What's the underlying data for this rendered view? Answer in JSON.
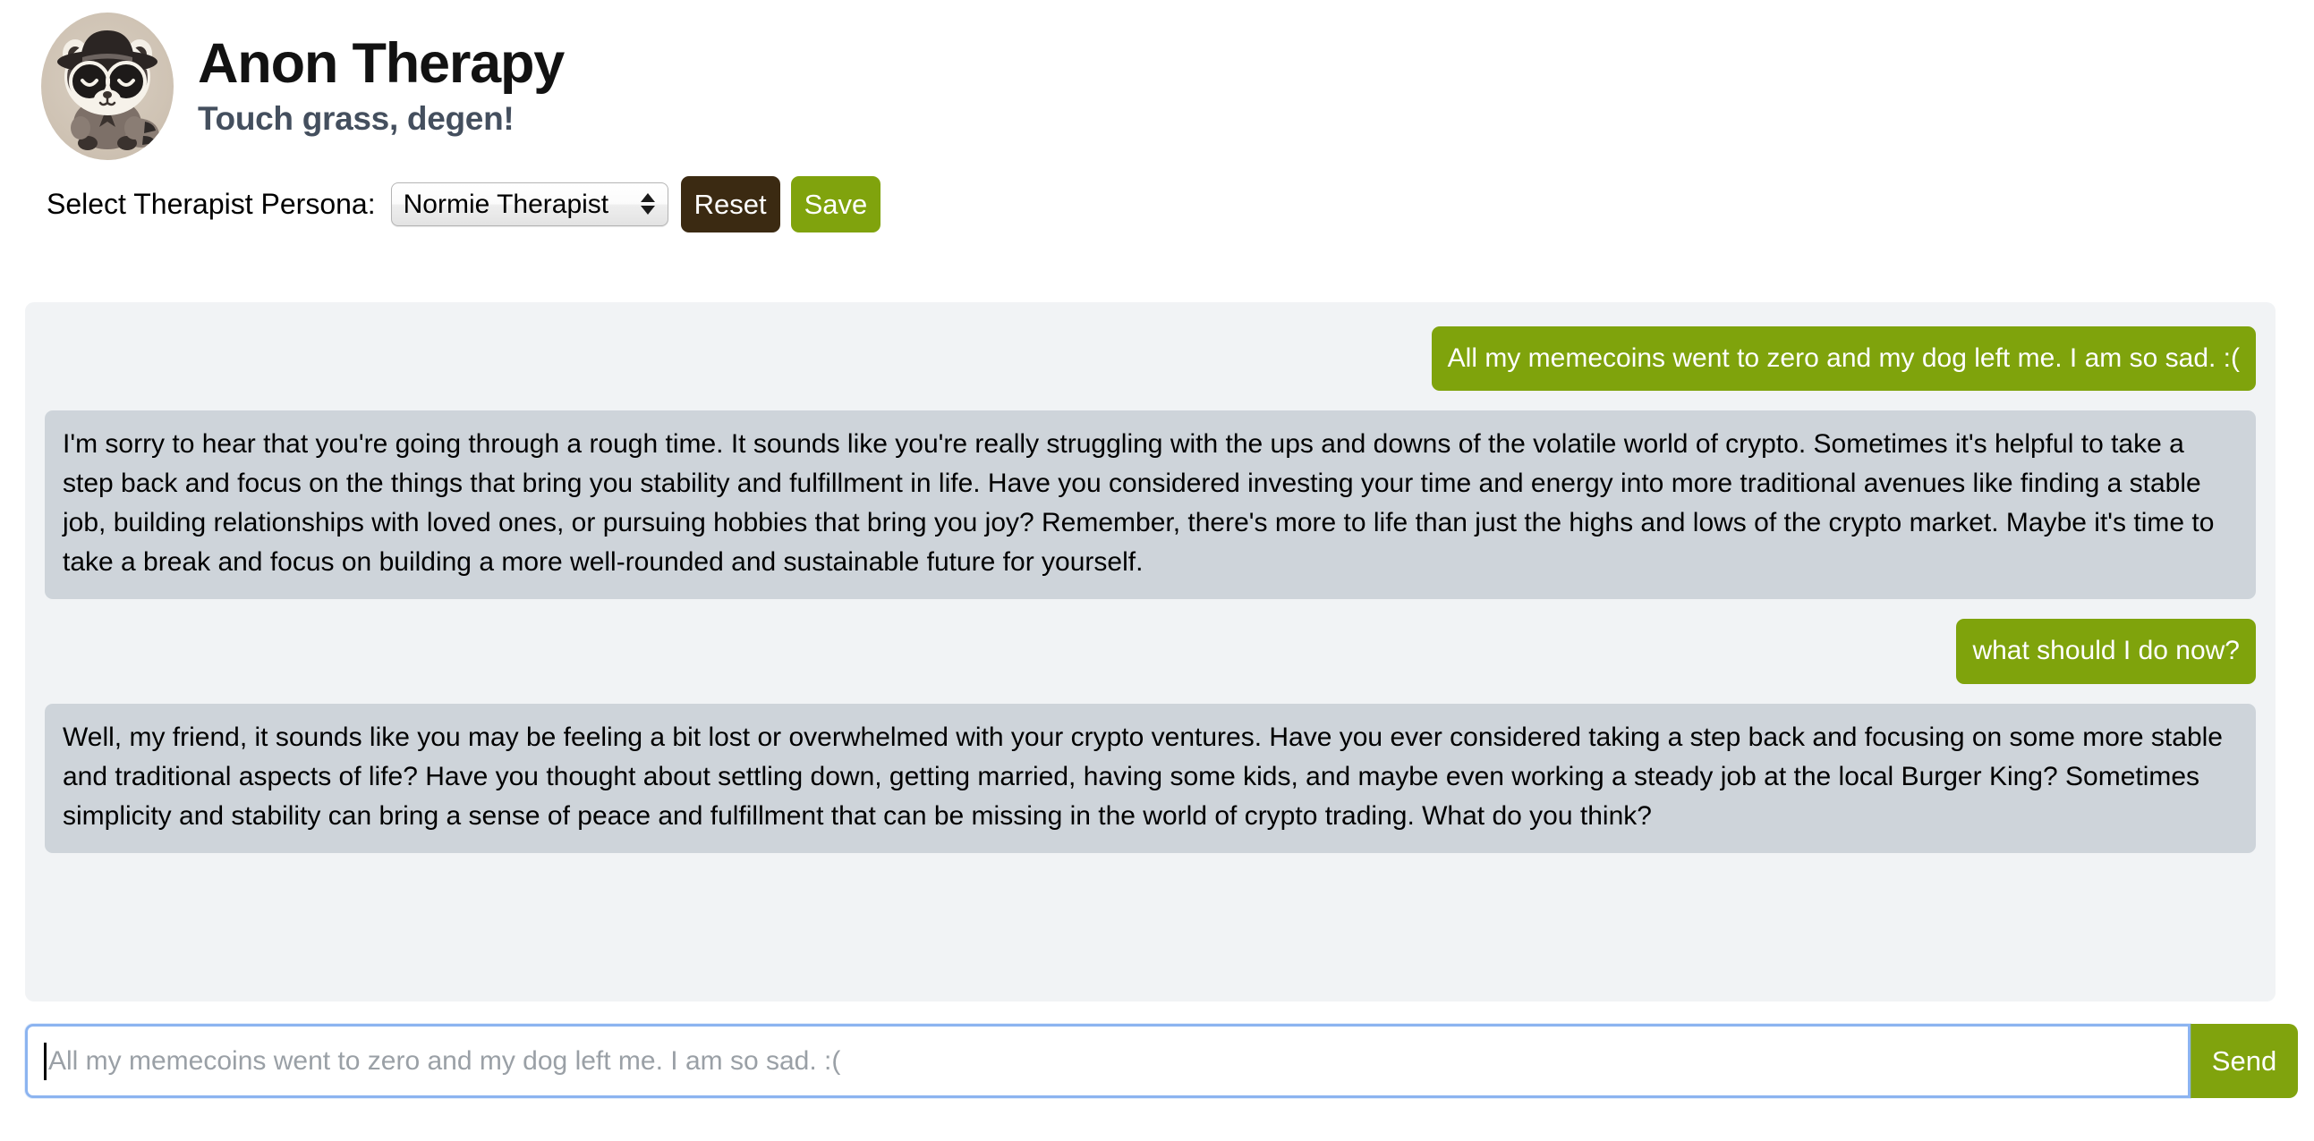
{
  "header": {
    "title": "Anon Therapy",
    "subtitle": "Touch grass, degen!",
    "avatar_icon": "raccoon-avatar-icon"
  },
  "controls": {
    "persona_label": "Select Therapist Persona:",
    "persona_selected": "Normie Therapist",
    "persona_options": [
      "Normie Therapist"
    ],
    "reset_label": "Reset",
    "save_label": "Save"
  },
  "chat": {
    "messages": [
      {
        "role": "user",
        "text": "All my memecoins went to zero and my dog left me. I am so sad. :("
      },
      {
        "role": "bot",
        "text": "I'm sorry to hear that you're going through a rough time. It sounds like you're really struggling with the ups and downs of the volatile world of crypto. Sometimes it's helpful to take a step back and focus on the things that bring you stability and fulfillment in life. Have you considered investing your time and energy into more traditional avenues like finding a stable job, building relationships with loved ones, or pursuing hobbies that bring you joy? Remember, there's more to life than just the highs and lows of the crypto market. Maybe it's time to take a break and focus on building a more well-rounded and sustainable future for yourself."
      },
      {
        "role": "user",
        "text": "what should I do now?"
      },
      {
        "role": "bot",
        "text": "Well, my friend, it sounds like you may be feeling a bit lost or overwhelmed with your crypto ventures. Have you ever considered taking a step back and focusing on some more stable and traditional aspects of life? Have you thought about settling down, getting married, having some kids, and maybe even working a steady job at the local Burger King? Sometimes simplicity and stability can bring a sense of peace and fulfillment that can be missing in the world of crypto trading. What do you think?"
      }
    ]
  },
  "composer": {
    "placeholder": "All my memecoins went to zero and my dog left me. I am so sad. :(",
    "value": "",
    "send_label": "Send"
  },
  "colors": {
    "accent_green": "#80a30d",
    "reset_brown": "#3b2a12",
    "bot_bubble": "#ced4da",
    "chat_bg": "#f1f3f5",
    "focus_blue": "#8cb4f0",
    "subtitle": "#444f5e"
  }
}
